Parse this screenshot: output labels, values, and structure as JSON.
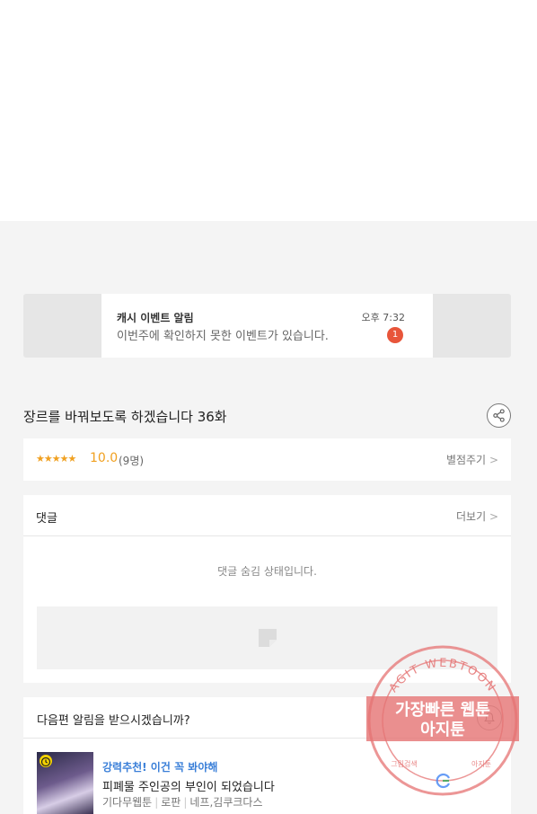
{
  "banner": {
    "title": "캐시 이벤트 알림",
    "time": "오후 7:32",
    "message": "이번주에 확인하지 못한 이벤트가 있습니다.",
    "badge_count": "1"
  },
  "episode": {
    "title": "장르를 바꿔보도록 하겠습니다 36화"
  },
  "rating": {
    "stars": "★★★★★",
    "score": "10.0",
    "count": "(9명)",
    "rate_label": "별점주기",
    "rate_chevron": ">"
  },
  "comments": {
    "title": "댓글",
    "more_label": "더보기",
    "more_chevron": ">",
    "hidden_message": "댓글 숨김 상태입니다."
  },
  "next_episode": {
    "prompt": "다음편 알림을 받으시겠습니까?"
  },
  "recommendation": {
    "tag": "강력추천! 이건 꼭 봐야해",
    "title": "피폐물 주인공의 부인이 되었습니다",
    "meta": [
      "기다무웹툰",
      "로판",
      "네프,김쿠크다스"
    ]
  },
  "watermark": {
    "arc_text": "AGIT WEBTOON",
    "line1": "가장빠른 웹툰",
    "line2": "아지툰",
    "bottom_left": "그림검색",
    "bottom_right": "아지툰"
  },
  "colors": {
    "accent_orange": "#f0a020",
    "badge_red": "#e8553a",
    "link_blue": "#3a7fd8",
    "watermark_red": "#e57373"
  }
}
